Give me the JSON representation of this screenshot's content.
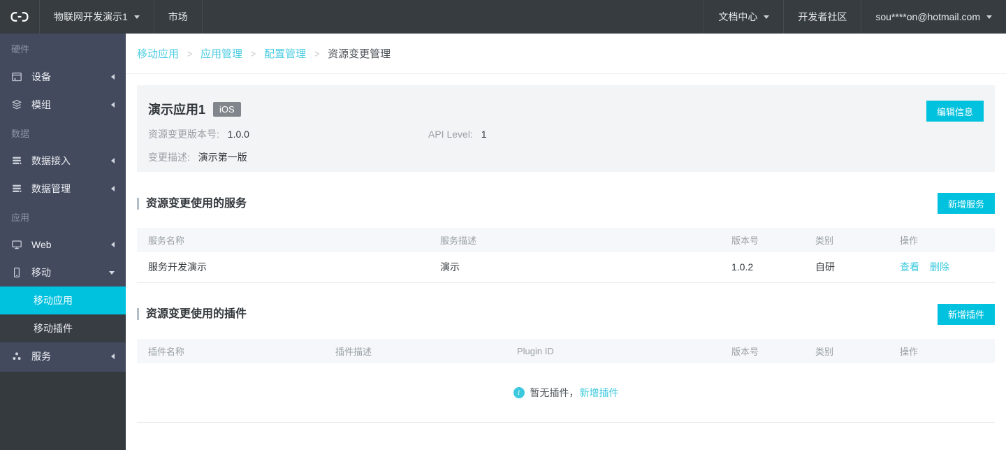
{
  "colors": {
    "accent": "#00c1de",
    "link": "#3cc9de",
    "topbar_bg": "#363c40",
    "sidebar_bg": "#434a5e",
    "sidebar_active": "#00c1de",
    "card_bg": "#f3f4f6",
    "table_header_bg": "#f5f7fa",
    "badge_bg": "#80868b"
  },
  "topbar": {
    "product_menu": "物联网开发演示1",
    "market": "市场",
    "docs": "文档中心",
    "community": "开发者社区",
    "account": "sou****on@hotmail.com"
  },
  "sidebar": {
    "sections": [
      {
        "label": "硬件",
        "items": [
          {
            "label": "设备",
            "icon": "device-icon"
          },
          {
            "label": "模组",
            "icon": "module-icon"
          }
        ]
      },
      {
        "label": "数据",
        "items": [
          {
            "label": "数据接入",
            "icon": "data-access-icon"
          },
          {
            "label": "数据管理",
            "icon": "data-manage-icon"
          }
        ]
      },
      {
        "label": "应用",
        "items": [
          {
            "label": "Web",
            "icon": "web-icon"
          },
          {
            "label": "移动",
            "icon": "mobile-icon",
            "expanded": true,
            "subitems": [
              {
                "label": "移动应用",
                "active": true
              },
              {
                "label": "移动插件",
                "active": false
              }
            ]
          },
          {
            "label": "服务",
            "icon": "service-icon"
          }
        ]
      }
    ]
  },
  "breadcrumb": {
    "links": [
      "移动应用",
      "应用管理",
      "配置管理"
    ],
    "current": "资源变更管理"
  },
  "app_card": {
    "title": "演示应用1",
    "platform_badge": "iOS",
    "edit_button": "编辑信息",
    "fields": [
      {
        "label": "资源变更版本号:",
        "value": "1.0.0"
      },
      {
        "label": "API Level:",
        "value": "1"
      },
      {
        "label": "变更描述:",
        "value": "演示第一版"
      }
    ]
  },
  "services_section": {
    "title": "资源变更使用的服务",
    "add_button": "新增服务",
    "table": {
      "headers": [
        "服务名称",
        "服务描述",
        "版本号",
        "类别",
        "操作"
      ],
      "rows": [
        {
          "name": "服务开发演示",
          "desc": "演示",
          "version": "1.0.2",
          "category": "自研",
          "actions": [
            "查看",
            "删除"
          ]
        }
      ]
    }
  },
  "plugins_section": {
    "title": "资源变更使用的插件",
    "add_button": "新增插件",
    "table": {
      "headers": [
        "插件名称",
        "插件描述",
        "Plugin ID",
        "版本号",
        "类别",
        "操作"
      ],
      "rows": []
    },
    "empty": {
      "text": "暂无插件，",
      "link": "新增插件"
    }
  }
}
